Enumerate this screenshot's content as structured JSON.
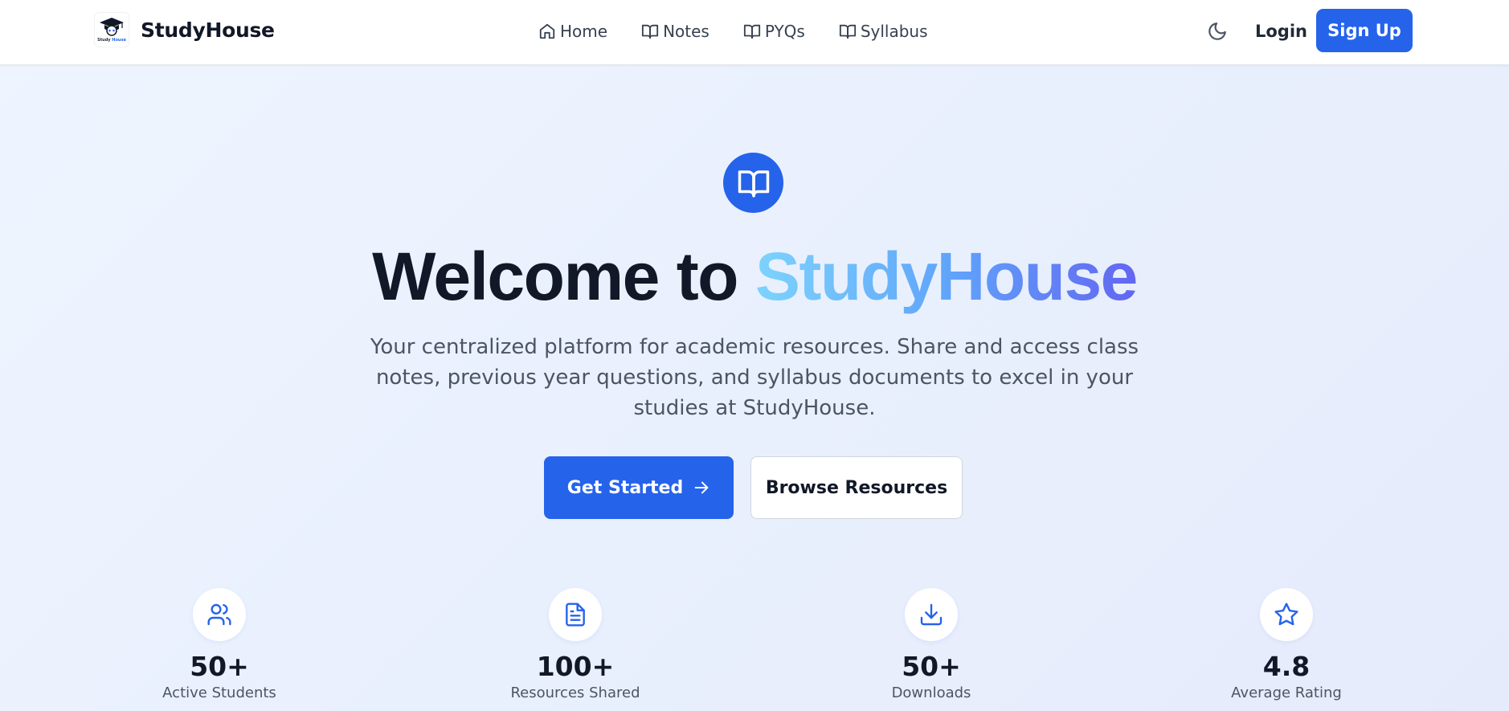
{
  "header": {
    "brand_name": "StudyHouse",
    "logo_text_1": "Study",
    "logo_text_2": "House",
    "nav": [
      {
        "label": "Home",
        "icon": "home-icon"
      },
      {
        "label": "Notes",
        "icon": "book-icon"
      },
      {
        "label": "PYQs",
        "icon": "book-icon"
      },
      {
        "label": "Syllabus",
        "icon": "book-icon"
      }
    ],
    "theme_toggle_icon": "moon-icon",
    "login_label": "Login",
    "signup_label": "Sign Up"
  },
  "hero": {
    "icon": "book-open-icon",
    "title_prefix": "Welcome to ",
    "title_highlight": "StudyHouse",
    "subtitle": "Your centralized platform for academic resources. Share and access class notes, previous year questions, and syllabus documents to excel in your studies at StudyHouse.",
    "primary_button": "Get Started",
    "secondary_button": "Browse Resources"
  },
  "stats": [
    {
      "value": "50+",
      "label": "Active Students",
      "icon": "users-icon"
    },
    {
      "value": "100+",
      "label": "Resources Shared",
      "icon": "file-text-icon"
    },
    {
      "value": "50+",
      "label": "Downloads",
      "icon": "download-icon"
    },
    {
      "value": "4.8",
      "label": "Average Rating",
      "icon": "star-icon"
    }
  ],
  "colors": {
    "primary": "#2563eb",
    "text_dark": "#111827",
    "text_muted": "#4b5563",
    "gradient_start": "#7dd3fc",
    "gradient_end": "#6366f1"
  }
}
